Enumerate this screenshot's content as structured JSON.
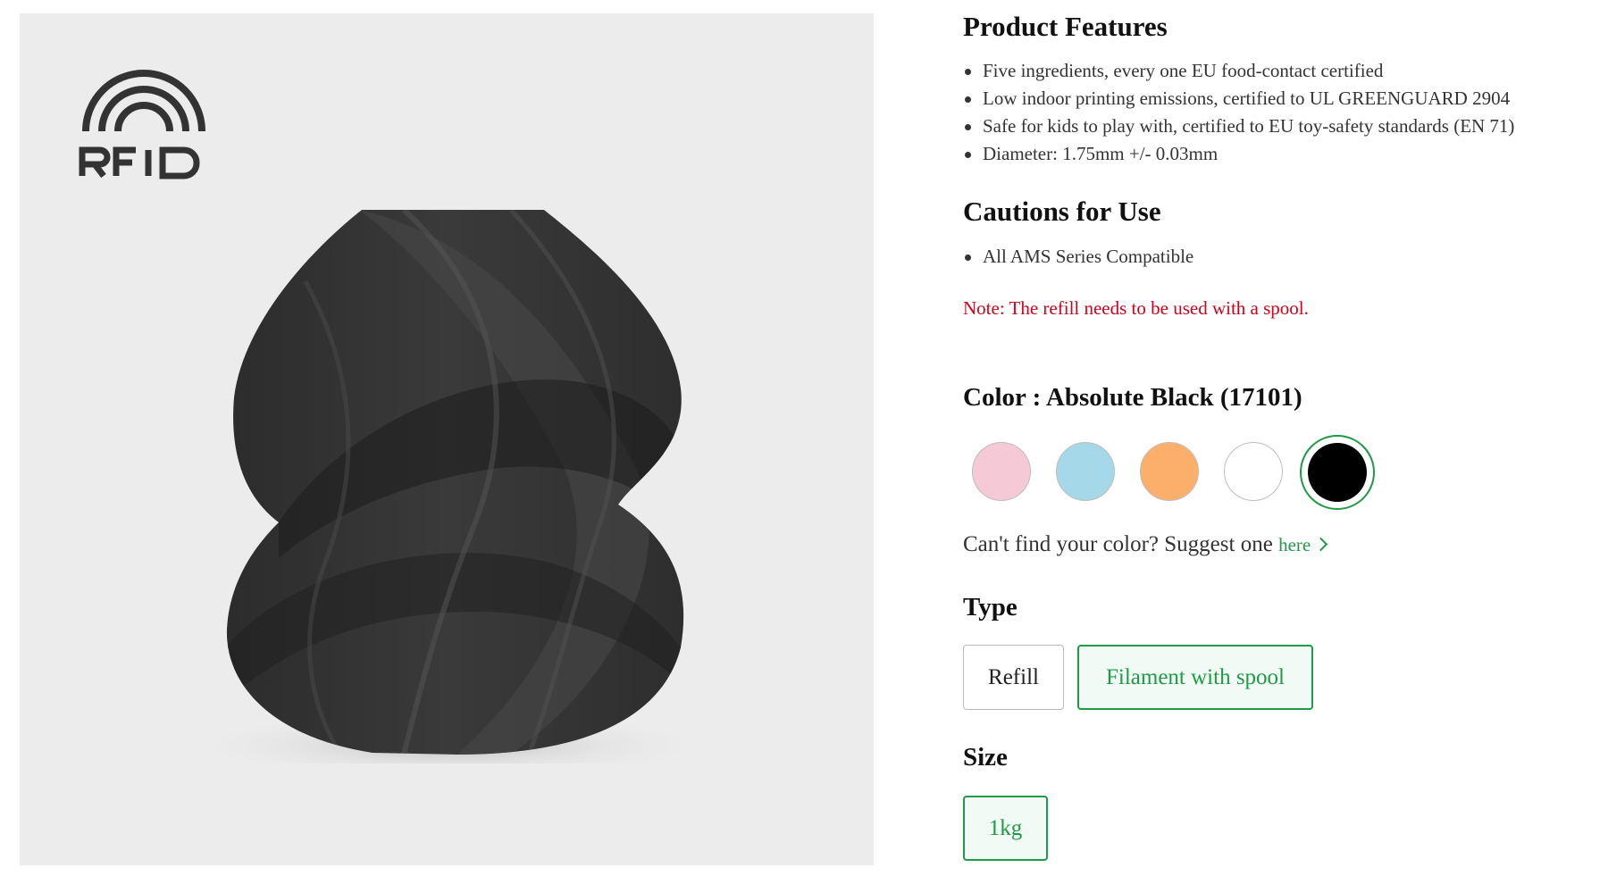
{
  "product_features": {
    "title": "Product Features",
    "items": [
      "Five ingredients, every one EU food-contact certified",
      "Low indoor printing emissions, certified to UL GREENGUARD 2904",
      "Safe for kids to play with, certified to EU toy-safety standards (EN 71)",
      "Diameter: 1.75mm +/- 0.03mm"
    ]
  },
  "cautions": {
    "title": "Cautions for Use",
    "items": [
      "All AMS Series Compatible"
    ]
  },
  "note": "Note: The refill needs to be used with a spool.",
  "color": {
    "heading": "Color : Absolute Black (17101)",
    "swatches": [
      {
        "name": "pink",
        "hex": "#f6c9d6"
      },
      {
        "name": "light-blue",
        "hex": "#a5d9ea"
      },
      {
        "name": "orange",
        "hex": "#fcae6b"
      },
      {
        "name": "white",
        "hex": "#ffffff"
      },
      {
        "name": "absolute-black",
        "hex": "#000000",
        "selected": true
      }
    ],
    "suggest_text": "Can't find your color? Suggest one",
    "suggest_link": "here"
  },
  "type": {
    "heading": "Type",
    "options": [
      {
        "label": "Refill",
        "selected": false
      },
      {
        "label": "Filament with spool",
        "selected": true
      }
    ]
  },
  "size": {
    "heading": "Size",
    "options": [
      {
        "label": "1kg",
        "selected": true
      }
    ]
  },
  "logo": {
    "text": "RFID"
  },
  "accent_color": "#1f9a47"
}
